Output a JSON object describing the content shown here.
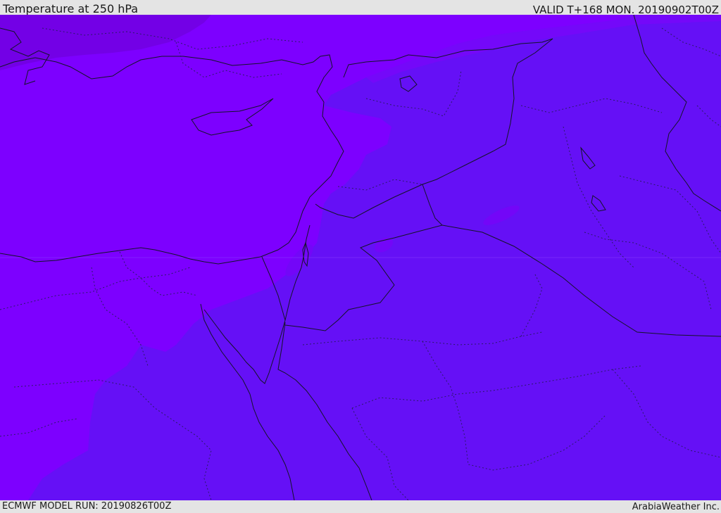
{
  "header": {
    "title": "Temperature at 250 hPa",
    "valid": "VALID T+168 MON. 20190902T00Z"
  },
  "footer": {
    "model_run": "ECMWF MODEL RUN: 20190826T00Z",
    "credit": "ArabiaWeather Inc."
  },
  "map": {
    "colors": {
      "coldest": "#7300e6",
      "cold": "#7d00ff",
      "mid": "#7e0df8",
      "warm": "#6510f6",
      "coastline": "#141428"
    }
  }
}
